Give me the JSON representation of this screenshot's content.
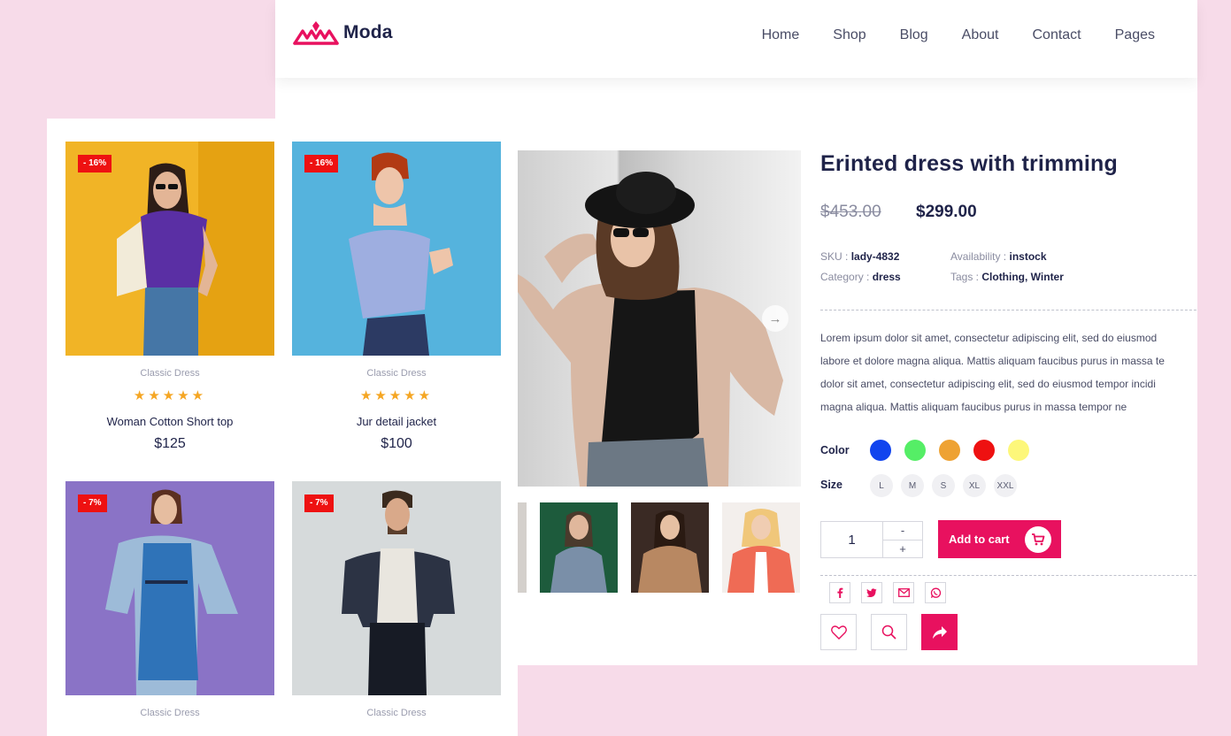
{
  "header": {
    "logo_text": "Moda",
    "nav": [
      "Home",
      "Shop",
      "Blog",
      "About",
      "Contact",
      "Pages"
    ]
  },
  "product": {
    "title": "Erinted dress with trimming",
    "old_price": "$453.00",
    "new_price": "$299.00",
    "sku_label": "SKU :",
    "sku": "lady-4832",
    "availability_label": "Availability :",
    "availability": "instock",
    "category_label": "Category :",
    "category": "dress",
    "tags_label": "Tags :",
    "tags": "Clothing, Winter",
    "description_lines": [
      "Lorem ipsum dolor sit amet, consectetur adipiscing elit, sed do eiusmod",
      "labore et dolore magna aliqua. Mattis aliquam faucibus purus in massa te",
      "dolor sit amet, consectetur adipiscing elit, sed do eiusmod tempor incidi",
      "magna aliqua. Mattis aliquam faucibus purus in massa tempor ne"
    ],
    "color_label": "Color",
    "colors": [
      "#1144ee",
      "#55ee66",
      "#eea233",
      "#ee1111",
      "#fdf77a"
    ],
    "size_label": "Size",
    "sizes": [
      "L",
      "M",
      "S",
      "XL",
      "XXL"
    ],
    "quantity": "1",
    "qty_minus": "-",
    "qty_plus": "+",
    "add_to_cart": "Add to cart",
    "icons": {
      "next": "arrow-right-icon",
      "cart": "cart-icon",
      "social": [
        "facebook-icon",
        "twitter-icon",
        "mail-icon",
        "whatsapp-icon"
      ],
      "actions": [
        "heart-icon",
        "search-icon",
        "share-icon"
      ]
    }
  },
  "grid": {
    "cards": [
      {
        "badge": "- 16%",
        "category": "Classic Dress",
        "stars": "★★★★★",
        "name": "Woman Cotton Short top",
        "price": "$125"
      },
      {
        "badge": "- 16%",
        "category": "Classic Dress",
        "stars": "★★★★★",
        "name": "Jur detail jacket",
        "price": "$100"
      },
      {
        "badge": "- 7%",
        "category": "Classic Dress"
      },
      {
        "badge": "- 7%",
        "category": "Classic Dress"
      }
    ]
  },
  "theme": {
    "accent": "#e8115f",
    "background": "#f7dbe9",
    "text": "#1f2349",
    "badge": "#ee1111",
    "star": "#f5a623"
  }
}
